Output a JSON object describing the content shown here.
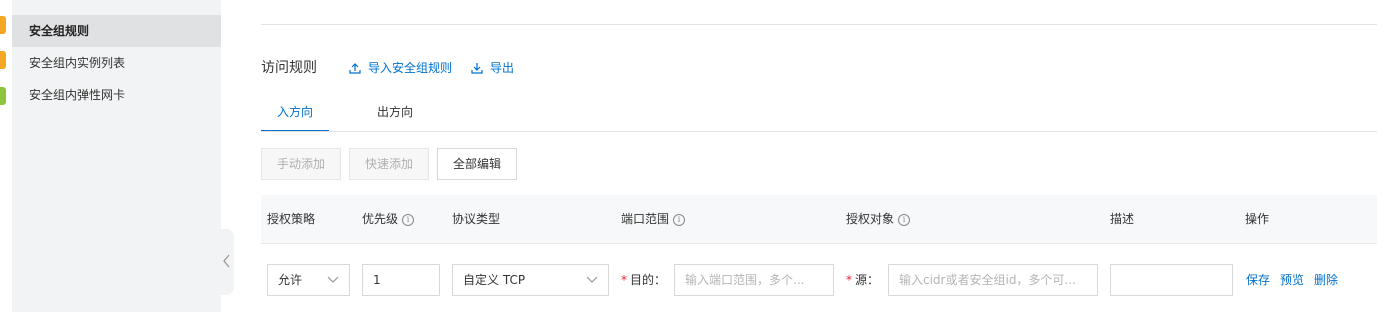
{
  "sidebar": {
    "items": [
      {
        "label": "安全组规则",
        "active": true
      },
      {
        "label": "安全组内实例列表",
        "active": false
      },
      {
        "label": "安全组内弹性网卡",
        "active": false
      }
    ]
  },
  "strip_icon_colors": [
    "#f5a623",
    "#f5a623",
    "#8cc63f"
  ],
  "accent_color": "#0070cc",
  "rules": {
    "title": "访问规则",
    "import_label": "导入安全组规则",
    "export_label": "导出"
  },
  "tabs": [
    {
      "label": "入方向",
      "active": true
    },
    {
      "label": "出方向",
      "active": false
    }
  ],
  "toolbar": {
    "manual_add": "手动添加",
    "quick_add": "快速添加",
    "edit_all": "全部编辑"
  },
  "table": {
    "headers": {
      "policy": "授权策略",
      "priority": "优先级",
      "protocol": "协议类型",
      "port_range": "端口范围",
      "auth_object": "授权对象",
      "description": "描述",
      "actions": "操作"
    },
    "row": {
      "policy": "允许",
      "priority": "1",
      "protocol": "自定义 TCP",
      "dest_label": "目的：",
      "port_placeholder": "输入端口范围，多个...",
      "source_label": "源：",
      "source_placeholder": "输入cidr或者安全组id，多个可...",
      "description": "",
      "save": "保存",
      "preview": "预览",
      "delete": "删除"
    }
  }
}
